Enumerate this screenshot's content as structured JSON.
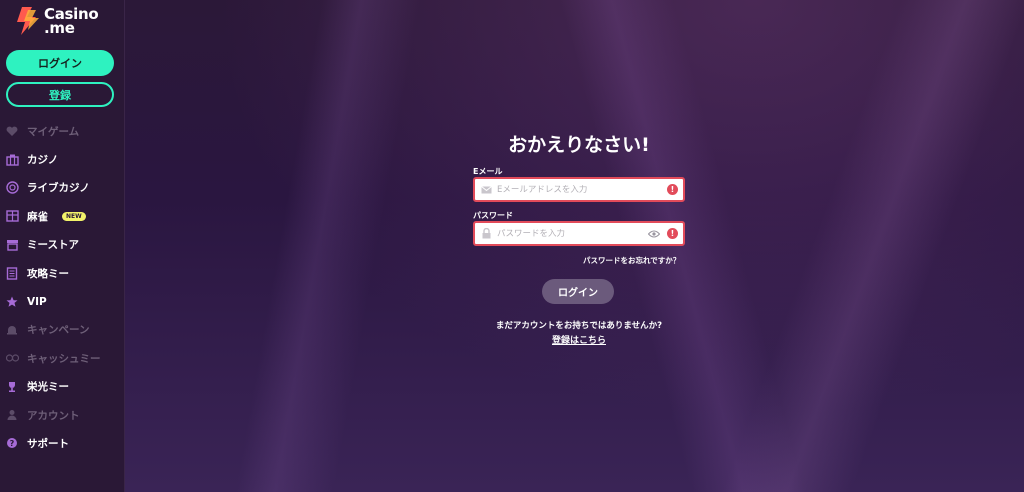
{
  "brand": {
    "line1": "Casino",
    "line2": ".me"
  },
  "sidebar": {
    "login_label": "ログイン",
    "register_label": "登録",
    "items": [
      {
        "label": "マイゲーム",
        "icon": "heart-icon",
        "dim": true
      },
      {
        "label": "カジノ",
        "icon": "casino-icon",
        "dim": false
      },
      {
        "label": "ライブカジノ",
        "icon": "chip-icon",
        "dim": false
      },
      {
        "label": "麻雀",
        "icon": "mahjong-icon",
        "dim": false,
        "badge": "NEW"
      },
      {
        "label": "ミーストア",
        "icon": "store-icon",
        "dim": false
      },
      {
        "label": "攻略ミー",
        "icon": "book-icon",
        "dim": false
      },
      {
        "label": "VIP",
        "icon": "star-icon",
        "dim": false
      },
      {
        "label": "キャンペーン",
        "icon": "bell-icon",
        "dim": true
      },
      {
        "label": "キャッシュミー",
        "icon": "cash-icon",
        "dim": true
      },
      {
        "label": "栄光ミー",
        "icon": "trophy-icon",
        "dim": false
      },
      {
        "label": "アカウント",
        "icon": "user-icon",
        "dim": true
      },
      {
        "label": "サポート",
        "icon": "support-icon",
        "dim": false
      }
    ]
  },
  "login_form": {
    "title": "おかえりなさい!",
    "email_label": "Eメール",
    "email_placeholder": "Eメールアドレスを入力",
    "password_label": "パスワード",
    "password_placeholder": "パスワードを入力",
    "forgot_label": "パスワードをお忘れですか？",
    "submit_label": "ログイン",
    "no_account_text": "まだアカウントをお持ちではありませんか?",
    "register_link_label": "登録はこちら"
  },
  "colors": {
    "accent": "#2ef2c0",
    "error": "#e24b5a",
    "sidebar_bg": "#2a1836",
    "submit_bg": "#6b5a7c"
  }
}
